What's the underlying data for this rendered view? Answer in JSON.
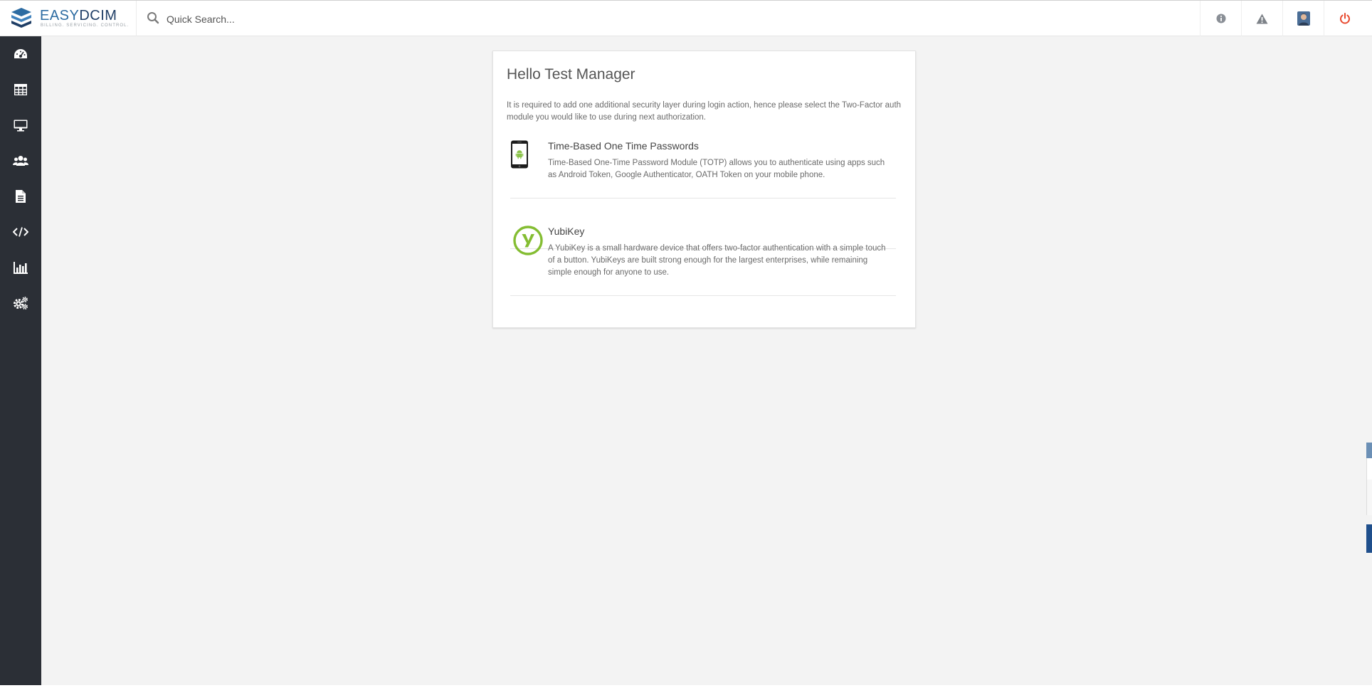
{
  "brand": {
    "name_light": "EASY",
    "name_strong": "DCIM",
    "tagline": "BILLING. SERVICING. CONTROL."
  },
  "search": {
    "placeholder": "Quick Search..."
  },
  "topbar": {
    "actions": [
      "info-icon",
      "warning-icon",
      "user-avatar",
      "power-icon"
    ],
    "power_color": "#e8492e"
  },
  "sidebar": {
    "items": [
      "dashboard-icon",
      "table-icon",
      "monitor-icon",
      "users-icon",
      "document-icon",
      "code-icon",
      "chart-icon",
      "settings-icon"
    ]
  },
  "card": {
    "title": "Hello Test Manager",
    "intro": "It is required to add one additional security layer during login action, hence please select the Two-Factor auth module you would like to use during next authorization.",
    "methods": [
      {
        "title": "Time-Based One Time Passwords",
        "description": "Time-Based One-Time Password Module (TOTP) allows you to authenticate using apps such as Android Token, Google Authenticator, OATH Token on your mobile phone.",
        "icon": "android-phone-icon"
      },
      {
        "title": "YubiKey",
        "description": "A YubiKey is a small hardware device that offers two-factor authentication with a simple touch of a button. YubiKeys are built strong enough for the largest enterprises, while remaining simple enough for anyone to use.",
        "icon": "yubikey-icon"
      }
    ]
  },
  "colors": {
    "sidebar_bg": "#2b2f36",
    "page_bg": "#f3f3f3",
    "brand_blue": "#2d6ca2",
    "android_green": "#8bc34a",
    "yubikey_green": "#84bd32"
  }
}
